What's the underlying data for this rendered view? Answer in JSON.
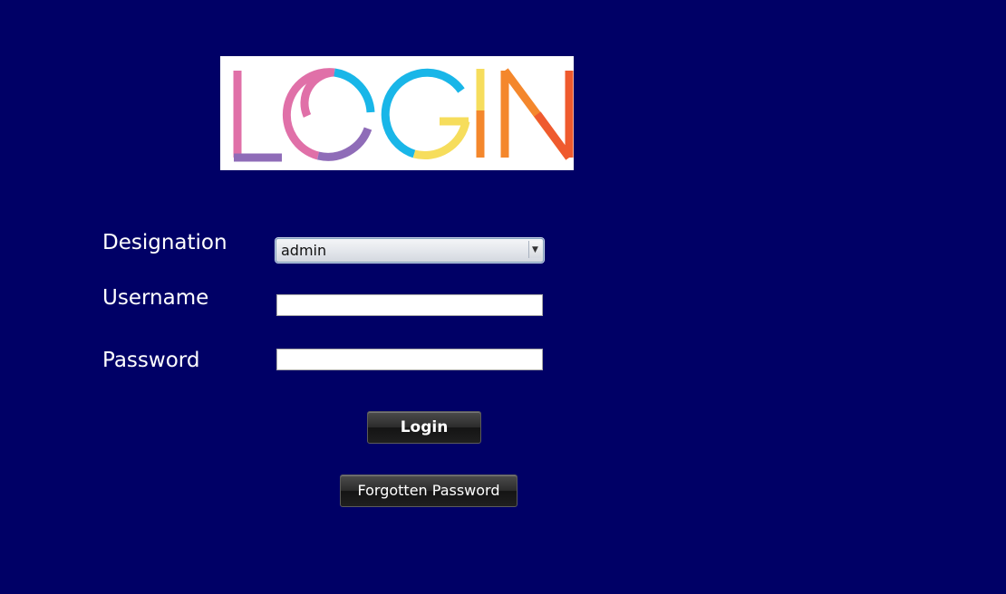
{
  "logo": {
    "text": "LOGIN",
    "colors": {
      "pink": "#e070a8",
      "purple": "#8f6cb8",
      "blue": "#19b6e8",
      "yellow": "#f6dd5c",
      "orange": "#f4872c",
      "red": "#ef5a2e"
    }
  },
  "form": {
    "designation_label": "Designation",
    "designation_value": "admin",
    "username_label": "Username",
    "username_value": "",
    "password_label": "Password",
    "password_value": ""
  },
  "buttons": {
    "login_label": "Login",
    "forgot_label": "Forgotten Password"
  },
  "colors": {
    "background": "#000066"
  }
}
